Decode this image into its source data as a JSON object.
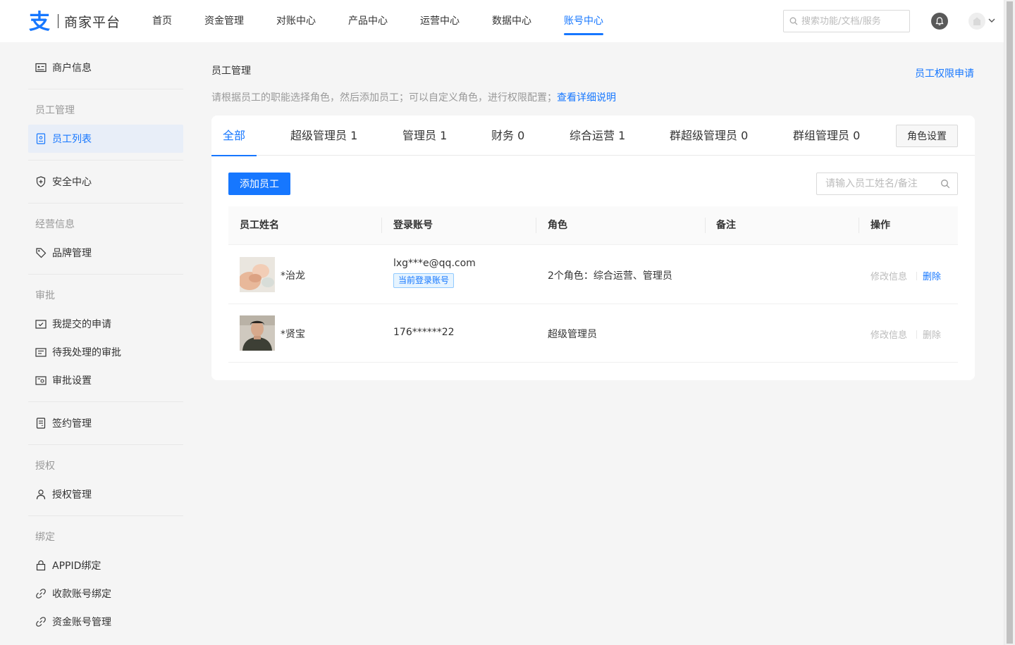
{
  "header": {
    "logo_text": "商家平台",
    "nav": [
      {
        "label": "首页",
        "active": false
      },
      {
        "label": "资金管理",
        "active": false
      },
      {
        "label": "对账中心",
        "active": false
      },
      {
        "label": "产品中心",
        "active": false
      },
      {
        "label": "运营中心",
        "active": false
      },
      {
        "label": "数据中心",
        "active": false
      },
      {
        "label": "账号中心",
        "active": true
      }
    ],
    "search_placeholder": "搜索功能/文档/服务"
  },
  "sidebar": {
    "merchant_info": "商户信息",
    "group_staff": "员工管理",
    "staff_list": "员工列表",
    "security": "安全中心",
    "group_business": "经营信息",
    "brand": "品牌管理",
    "group_approval": "审批",
    "my_requests": "我提交的申请",
    "pending_approvals": "待我处理的审批",
    "approval_settings": "审批设置",
    "contracts": "签约管理",
    "group_auth": "授权",
    "auth_mgmt": "授权管理",
    "group_binding": "绑定",
    "appid_binding": "APPID绑定",
    "payee_binding": "收款账号绑定",
    "fund_account": "资金账号管理"
  },
  "main": {
    "title": "员工管理",
    "perm_link": "员工权限申请",
    "description": "请根据员工的职能选择角色，然后添加员工；可以自定义角色，进行权限配置；",
    "description_link": "查看详细说明",
    "tabs": [
      {
        "label": "全部",
        "count": "",
        "active": true
      },
      {
        "label": "超级管理员",
        "count": "1",
        "active": false
      },
      {
        "label": "管理员",
        "count": "1",
        "active": false
      },
      {
        "label": "财务",
        "count": "0",
        "active": false
      },
      {
        "label": "综合运营",
        "count": "1",
        "active": false
      },
      {
        "label": "群超级管理员",
        "count": "0",
        "active": false
      },
      {
        "label": "群组管理员",
        "count": "0",
        "active": false
      }
    ],
    "role_settings": "角色设置",
    "add_button": "添加员工",
    "staff_search_placeholder": "请输入员工姓名/备注",
    "table": {
      "headers": [
        "员工姓名",
        "登录账号",
        "角色",
        "备注",
        "操作"
      ],
      "rows": [
        {
          "name": "*治龙",
          "account": "lxg***e@qq.com",
          "badge": "当前登录账号",
          "role": "2个角色：综合运营、管理员",
          "note": "",
          "edit": "修改信息",
          "delete": "删除",
          "delete_enabled": true
        },
        {
          "name": "*贤宝",
          "account": "176******22",
          "badge": "",
          "role": "超级管理员",
          "note": "",
          "edit": "修改信息",
          "delete": "删除",
          "delete_enabled": false
        }
      ]
    }
  },
  "colors": {
    "brand": "#1677ff",
    "badge_bg": "#e6f4ff"
  }
}
